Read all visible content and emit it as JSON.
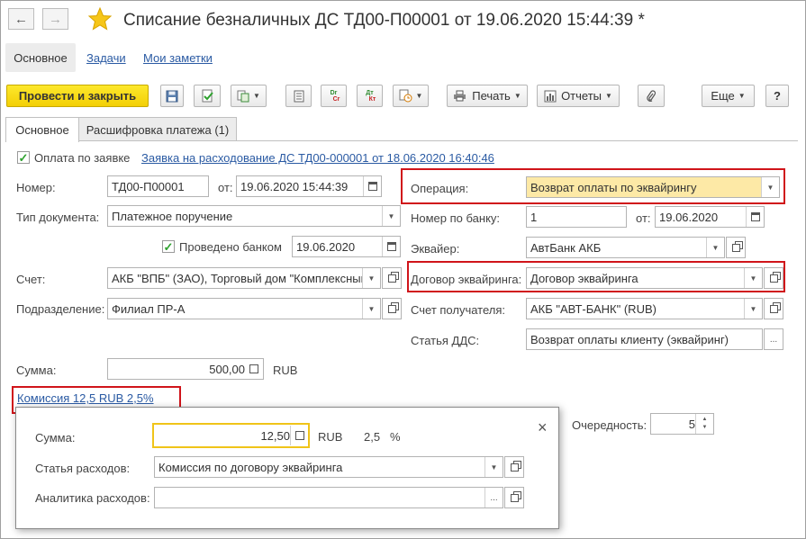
{
  "window": {
    "title": "Списание безналичных ДС ТД00-П00001 от 19.06.2020 15:44:39 *",
    "nav_back": "←",
    "nav_forward": "→",
    "star_icon": "star-icon"
  },
  "top_tabs": {
    "main": "Основное",
    "tasks": "Задачи",
    "notes": "Мои заметки"
  },
  "toolbar": {
    "post_close": "Провести и закрыть",
    "print": "Печать",
    "reports": "Отчеты",
    "more": "Еще",
    "help": "?",
    "dt_kt": "Дт Кт",
    "dr_cr": "Dr Cr"
  },
  "form_tabs": {
    "main": "Основное",
    "decode": "Расшифровка платежа (1)"
  },
  "form": {
    "pay_by_request_label": "Оплата по заявке",
    "pay_by_request_checked": true,
    "request_link": "Заявка на расходование ДС ТД00-000001 от 18.06.2020 16:40:46",
    "number_label": "Номер:",
    "number_value": "ТД00-П00001",
    "from_label": "от:",
    "date_value": "19.06.2020 15:44:39",
    "doc_type_label": "Тип документа:",
    "doc_type_value": "Платежное поручение",
    "bank_processed_label": "Проведено банком",
    "bank_processed_checked": true,
    "bank_date_value": "19.06.2020",
    "account_label": "Счет:",
    "account_value": "АКБ \"ВПБ\" (ЗАО), Торговый дом \"Комплексный\"",
    "division_label": "Подразделение:",
    "division_value": "Филиал ПР-А",
    "sum_label": "Сумма:",
    "sum_value": "500,00",
    "currency": "RUB",
    "commission_link": "Комиссия 12,5 RUB 2,5%",
    "operation_label": "Операция:",
    "operation_value": "Возврат оплаты по эквайрингу",
    "bank_number_label": "Номер по банку:",
    "bank_number_value": "1",
    "bank_number_from_label": "от:",
    "bank_number_date": "19.06.2020",
    "acquirer_label": "Эквайер:",
    "acquirer_value": "АвтБанк АКБ",
    "contract_label": "Договор эквайринга:",
    "contract_value": "Договор эквайринга",
    "recipient_account_label": "Счет получателя:",
    "recipient_account_value": "АКБ \"АВТ-БАНК\" (RUB)",
    "dds_label": "Статья ДДС:",
    "dds_value": "Возврат оплаты клиенту (эквайринг)",
    "priority_label": "Очередность:",
    "priority_value": "5"
  },
  "popup": {
    "sum_label": "Сумма:",
    "sum_value": "12,50",
    "currency": "RUB",
    "percent_value": "2,5",
    "percent_sign": "%",
    "expense_item_label": "Статья расходов:",
    "expense_item_value": "Комиссия по договору эквайринга",
    "analytics_label": "Аналитика расходов:",
    "analytics_value": "",
    "close": "×"
  },
  "colors": {
    "primary_button": "#f5d410",
    "highlight_field": "#fde9a6",
    "link": "#2a5aa3",
    "annotation_border": "#d0141a",
    "check": "#2ea12e"
  }
}
